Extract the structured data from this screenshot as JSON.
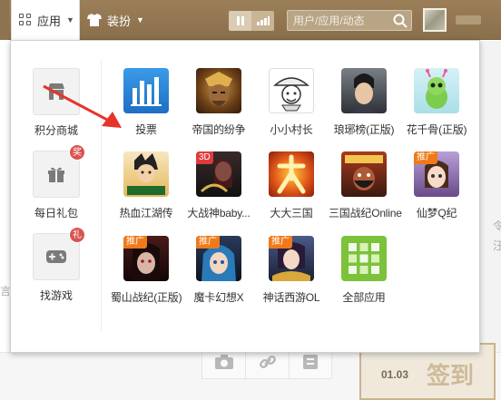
{
  "topbar": {
    "apps_tab_label": "应用",
    "dress_tab_label": "装扮",
    "search_placeholder": "用户/应用/动态"
  },
  "sidebar": {
    "items": [
      {
        "label": "积分商城",
        "icon": "shop-icon",
        "badge": ""
      },
      {
        "label": "每日礼包",
        "icon": "gift-icon",
        "badge": "奖"
      },
      {
        "label": "找游戏",
        "icon": "gamepad-icon",
        "badge": "礼"
      }
    ]
  },
  "apps": [
    {
      "label": "投票",
      "icon": "vote-chart-icon",
      "tag": ""
    },
    {
      "label": "帝国的纷争",
      "icon": "empire-game-icon",
      "tag": ""
    },
    {
      "label": "小小村长",
      "icon": "village-chief-icon",
      "tag": ""
    },
    {
      "label": "琅琊榜(正版)",
      "icon": "langya-game-icon",
      "tag": ""
    },
    {
      "label": "花千骨(正版)",
      "icon": "huaqiangu-game-icon",
      "tag": ""
    },
    {
      "label": "热血江湖传",
      "icon": "rexue-game-icon",
      "tag": ""
    },
    {
      "label": "大战神baby...",
      "icon": "dazhanshen-game-icon",
      "tag": "3D"
    },
    {
      "label": "大大三国",
      "icon": "dada-sanguo-game-icon",
      "tag": ""
    },
    {
      "label": "三国战纪Online",
      "icon": "sanguo-zhanji-game-icon",
      "tag": ""
    },
    {
      "label": "仙梦Q纪",
      "icon": "xianmeng-game-icon",
      "tag": "推广"
    },
    {
      "label": "蜀山战纪(正版)",
      "icon": "shushan-game-icon",
      "tag": "推广"
    },
    {
      "label": "魔卡幻想X",
      "icon": "moka-game-icon",
      "tag": "推广"
    },
    {
      "label": "神话西游OL",
      "icon": "shenhua-xiyou-game-icon",
      "tag": "推广"
    },
    {
      "label": "全部应用",
      "icon": "all-apps-icon",
      "tag": ""
    }
  ],
  "background": {
    "checkin_date": "01.03",
    "checkin_word": "签到",
    "left_fragment": "言",
    "right_fragments": [
      "令",
      "汪"
    ]
  },
  "colors": {
    "topbar": "#8f7450",
    "promo_tag": "#f07a1a",
    "badge": "#d9534f",
    "arrow": "#e8332a"
  }
}
